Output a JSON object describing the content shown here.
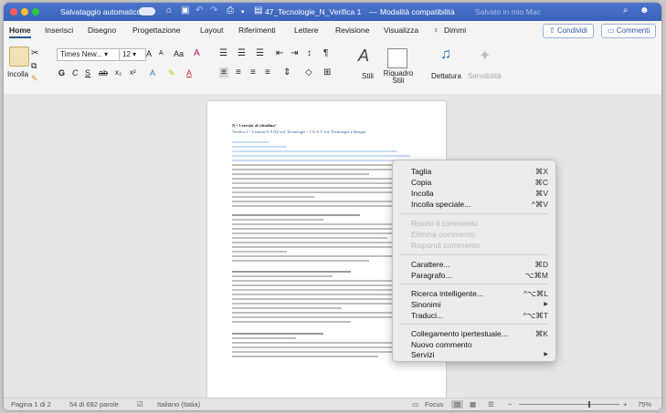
{
  "titlebar": {
    "autosave_label": "Salvataggio automatico",
    "doc_title": "47_Tecnologie_N_Verifica 1",
    "mode": "Modalità compatibilità",
    "saved_status": "Salvato in mio Mac",
    "separator": "—"
  },
  "tabs": [
    "Home",
    "Inserisci",
    "Disegno",
    "Progettazione",
    "Layout",
    "Riferimenti",
    "Lettere",
    "Revisione",
    "Visualizza"
  ],
  "tell_me": "Dimmi",
  "share_label": "Condividi",
  "comments_label": "Commenti",
  "ribbon": {
    "paste_label": "Incolla",
    "font_name": "Times New...",
    "font_size": "12",
    "grow_font": "A",
    "shrink_font": "A",
    "change_case": "Aa",
    "bold": "G",
    "italic": "C",
    "underline": "S",
    "styles_label": "Stili",
    "styles_pane_label": "Riquadro Stili",
    "dictate_label": "Dettatura",
    "sensitivity_label": "Sensibilità"
  },
  "document": {
    "heading_line": "N • 3 servizi al cittadino°",
    "subheading_line": "Verifica 1 ° Lezioni N 9 N2 vol. Tecnologie - 1 A.A.T vol. Tecnologie e disegni"
  },
  "context_menu": {
    "items": [
      {
        "label": "Taglia",
        "shortcut": "⌘X",
        "disabled": false
      },
      {
        "label": "Copia",
        "shortcut": "⌘C",
        "disabled": false
      },
      {
        "label": "Incolla",
        "shortcut": "⌘V",
        "disabled": false
      },
      {
        "label": "Incolla speciale...",
        "shortcut": "^⌘V",
        "disabled": false
      },
      {
        "label": "Risolvi il commento",
        "shortcut": "",
        "disabled": true
      },
      {
        "label": "Elimina commento",
        "shortcut": "",
        "disabled": true
      },
      {
        "label": "Rispondi commento",
        "shortcut": "",
        "disabled": true
      },
      {
        "label": "Carattere...",
        "shortcut": "⌘D",
        "disabled": false
      },
      {
        "label": "Paragrafo...",
        "shortcut": "⌥⌘M",
        "disabled": false
      },
      {
        "label": "Ricerca intelligente...",
        "shortcut": "^⌥⌘L",
        "disabled": false
      },
      {
        "label": "Sinonimi",
        "shortcut": "▶",
        "disabled": false
      },
      {
        "label": "Traduci...",
        "shortcut": "^⌥⌘T",
        "disabled": false
      },
      {
        "label": "Collegamento ipertestuale...",
        "shortcut": "⌘K",
        "disabled": false
      },
      {
        "label": "Nuovo commento",
        "shortcut": "",
        "disabled": false
      },
      {
        "label": "Servizi",
        "shortcut": "▶",
        "disabled": false
      }
    ]
  },
  "statusbar": {
    "page": "Pagina 1 di 2",
    "words": "54 di 692 parole",
    "language": "Italiano (Italia)",
    "focus": "Focus",
    "zoom": "75%"
  },
  "colors": {
    "accent": "#2b579a",
    "titlebar": "#3a63bb"
  }
}
